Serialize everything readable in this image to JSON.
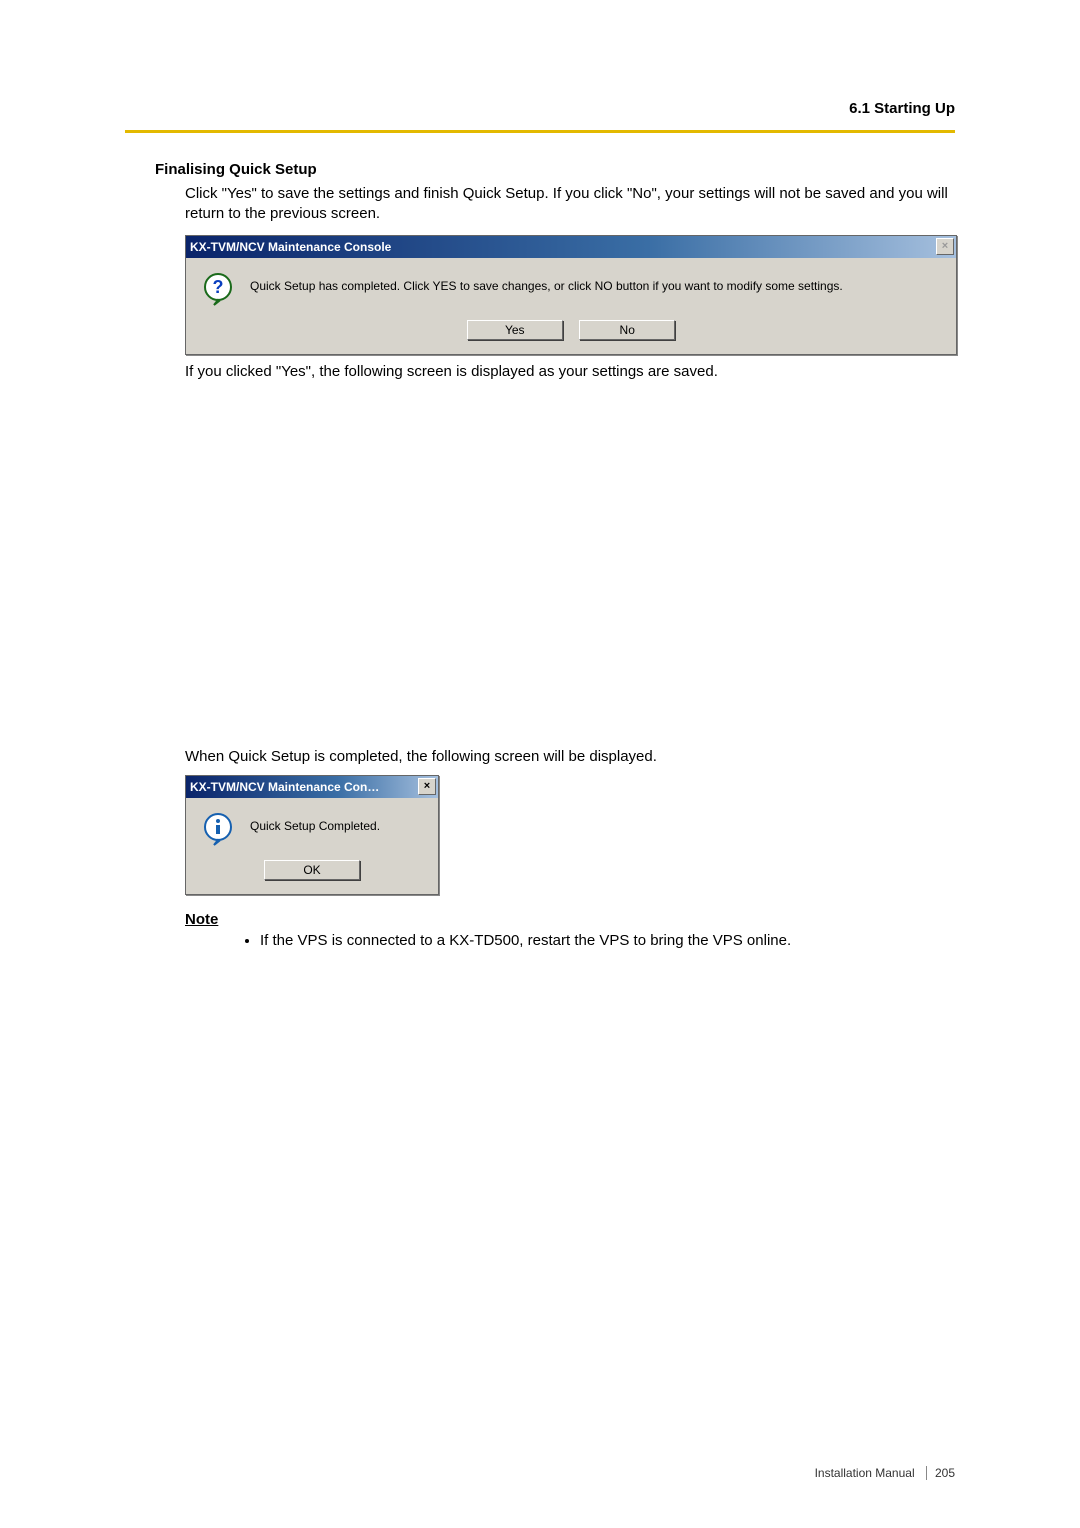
{
  "header": {
    "section": "6.1 Starting Up"
  },
  "subhead": "Finalising Quick Setup",
  "intro": "Click \"Yes\" to save the settings and finish Quick Setup. If you click \"No\", your settings will not be saved and you will return to the previous screen.",
  "dialog1": {
    "title": "KX-TVM/NCV Maintenance Console",
    "message": "Quick Setup has completed. Click YES to save changes, or click NO button if you want to modify some settings.",
    "yes": "Yes",
    "no": "No",
    "close": "×"
  },
  "after1": "If you clicked \"Yes\", the following screen is displayed as your settings are saved.",
  "after2": "When Quick Setup is completed, the following screen will be displayed.",
  "dialog2": {
    "title": "KX-TVM/NCV Maintenance Con…",
    "message": "Quick Setup Completed.",
    "ok": "OK",
    "close": "×"
  },
  "note": {
    "head": "Note",
    "item1": "If the VPS is connected to a KX-TD500, restart the VPS to bring the VPS online."
  },
  "footer": {
    "doc": "Installation Manual",
    "page": "205"
  }
}
